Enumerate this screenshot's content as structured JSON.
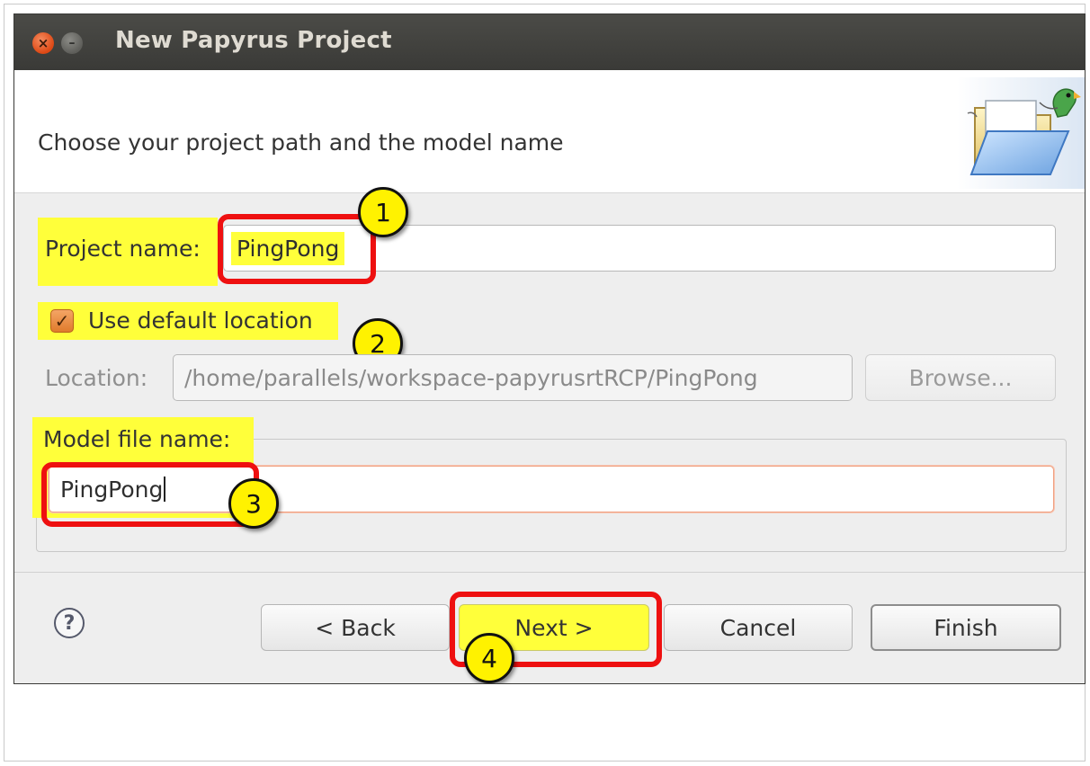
{
  "window": {
    "title": "New Papyrus Project"
  },
  "header": {
    "description": "Choose your project path and the model name"
  },
  "form": {
    "project_name_label": "Project name:",
    "project_name_value": "PingPong",
    "use_default_location_label": "Use default location",
    "use_default_location_checked": true,
    "location_label": "Location:",
    "location_value": "/home/parallels/workspace-papyrusrtRCP/PingPong",
    "browse_label": "Browse...",
    "model_file_group_label": "Model file name:",
    "model_file_value": "PingPong"
  },
  "buttons": {
    "back": "< Back",
    "next": "Next >",
    "cancel": "Cancel",
    "finish": "Finish"
  },
  "help": {
    "glyph": "?"
  },
  "callouts": [
    "1",
    "2",
    "3",
    "4"
  ],
  "icons": {
    "close": "×",
    "minimize": "–",
    "check": "✓",
    "wizard": "open-folder-with-parrot-icon"
  },
  "colors": {
    "highlight": "#ffff3a",
    "annotation_border": "#ee1010",
    "callout_fill": "#fff200",
    "titlebar": "#3c3b37",
    "close_button": "#dd4814"
  }
}
